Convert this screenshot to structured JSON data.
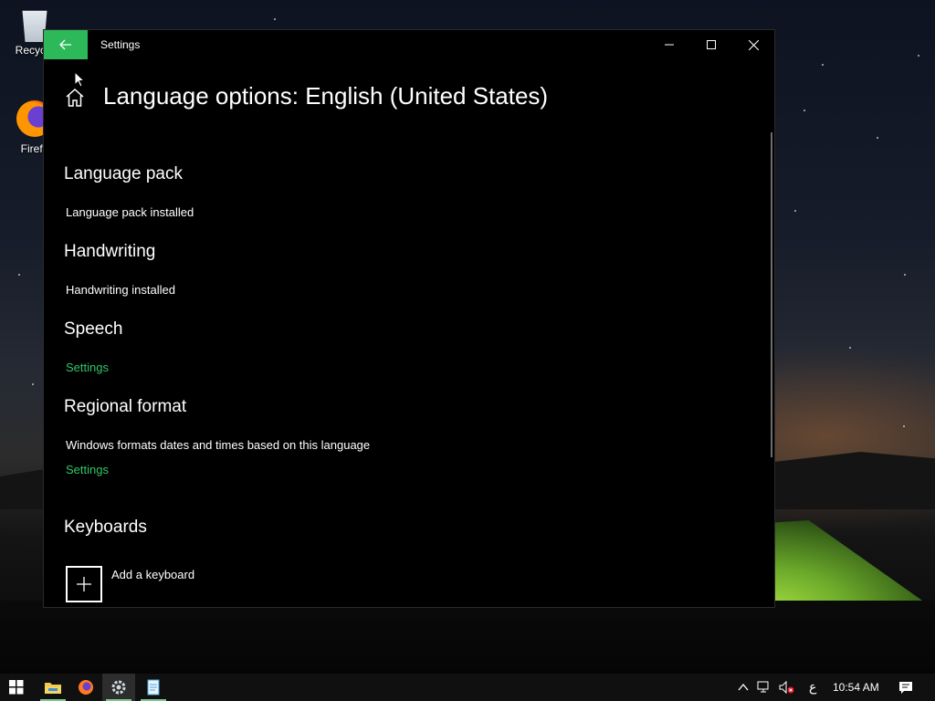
{
  "desktop": {
    "icons": [
      {
        "label": "Recycle",
        "icon": "recycle-bin-icon"
      },
      {
        "label": "Firefo",
        "icon": "firefox-icon"
      }
    ]
  },
  "window": {
    "title": "Settings",
    "page_title": "Language options: English (United States)",
    "accent_color": "#2db85a",
    "link_color": "#2fc766",
    "sections": {
      "language_pack": {
        "heading": "Language pack",
        "status": "Language pack installed"
      },
      "handwriting": {
        "heading": "Handwriting",
        "status": "Handwriting installed"
      },
      "speech": {
        "heading": "Speech",
        "link": "Settings"
      },
      "regional_format": {
        "heading": "Regional format",
        "description": "Windows formats dates and times based on this language",
        "link": "Settings"
      },
      "keyboards": {
        "heading": "Keyboards",
        "add_label": "Add a keyboard"
      }
    }
  },
  "taskbar": {
    "apps": [
      "start-icon",
      "file-explorer-icon",
      "firefox-icon",
      "settings-icon",
      "notepad-icon"
    ],
    "ime_indicator": "ع",
    "time": "10:54 AM"
  }
}
